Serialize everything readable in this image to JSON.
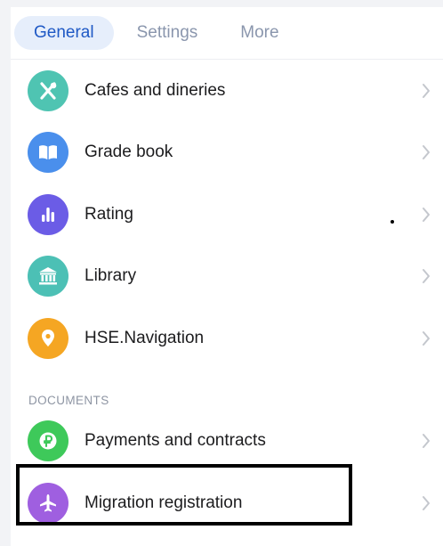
{
  "tabs": [
    {
      "label": "General",
      "active": true
    },
    {
      "label": "Settings",
      "active": false
    },
    {
      "label": "More",
      "active": false
    }
  ],
  "items": [
    {
      "label": "Cafes and dineries",
      "icon": "fork-knife-icon",
      "color": "#4fc4b2"
    },
    {
      "label": "Grade book",
      "icon": "book-icon",
      "color": "#4a8fec"
    },
    {
      "label": "Rating",
      "icon": "bar-chart-icon",
      "color": "#6b5ce6"
    },
    {
      "label": "Library",
      "icon": "bank-icon",
      "color": "#4cc0b5"
    },
    {
      "label": "HSE.Navigation",
      "icon": "map-pin-icon",
      "color": "#f5a623"
    }
  ],
  "documents_header": "DOCUMENTS",
  "documents": [
    {
      "label": "Payments and contracts",
      "icon": "ruble-icon",
      "color": "#3ec95a"
    },
    {
      "label": "Migration registration",
      "icon": "airplane-icon",
      "color": "#9f5fe0"
    }
  ]
}
